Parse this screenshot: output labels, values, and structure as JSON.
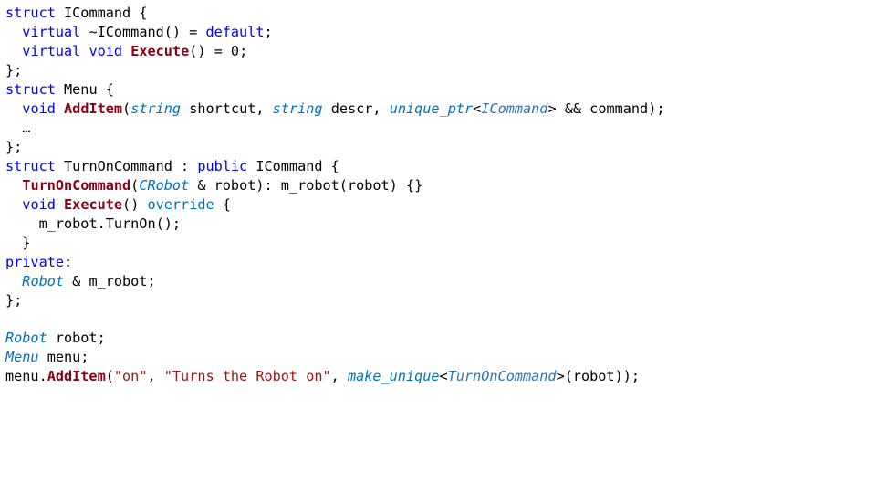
{
  "code": {
    "block1": {
      "l1": {
        "kw1": "struct",
        "name": " ICommand {"
      },
      "l2": {
        "pad": "  ",
        "kw1": "virtual",
        "rest": " ~ICommand() = ",
        "kw2": "default",
        "semi": ";"
      },
      "l3": {
        "pad": "  ",
        "kw1": "virtual",
        "sp": " ",
        "kw2": "void",
        "sp2": " ",
        "fn": "Execute",
        "rest": "() = 0;"
      },
      "l4": "};",
      "l5": {
        "kw1": "struct",
        "name": " Menu {"
      },
      "l6": {
        "pad": "  ",
        "kw1": "void",
        "sp": " ",
        "fn": "AddItem",
        "open": "(",
        "t1": "string",
        "a1": " shortcut, ",
        "t2": "string",
        "a2": " descr, ",
        "t3": "unique_ptr",
        "lt": "<",
        "targ": "ICommand",
        "gt": ">",
        "rest": " && command);"
      },
      "l7": "  …",
      "l8": "};"
    },
    "block2": {
      "l1": {
        "kw1": "struct",
        "mid": " TurnOnCommand : ",
        "kw2": "public",
        "rest": " ICommand {"
      },
      "l2": {
        "pad": "  ",
        "fn": "TurnOnCommand",
        "open": "(",
        "t1": "CRobot",
        "rest": " & robot): m_robot(robot) {}"
      },
      "l3": {
        "pad": "  ",
        "kw1": "void",
        "sp": " ",
        "fn": "Execute",
        "paren": "() ",
        "ov": "override",
        "brace": " {"
      },
      "l4": {
        "pad": "    ",
        "body": "m_robot.TurnOn();"
      },
      "l5": "  }",
      "l6": {
        "kw1": "private",
        "colon": ":"
      },
      "l7": {
        "pad": "  ",
        "t1": "Robot",
        "rest": " & m_robot;"
      },
      "l8": "};"
    },
    "block3": {
      "l1": {
        "t1": "Robot",
        "rest": " robot;"
      },
      "l2": {
        "t1": "Menu",
        "rest": " menu;"
      },
      "l3": {
        "pre": "menu.",
        "fn": "AddItem",
        "open": "(",
        "s1": "\"on\"",
        "c1": ", ",
        "s2": "\"Turns the Robot on\"",
        "c2": ", ",
        "mk": "make_unique",
        "lt": "<",
        "targ": "TurnOnCommand",
        "gt": ">",
        "rest": "(robot));"
      }
    }
  }
}
